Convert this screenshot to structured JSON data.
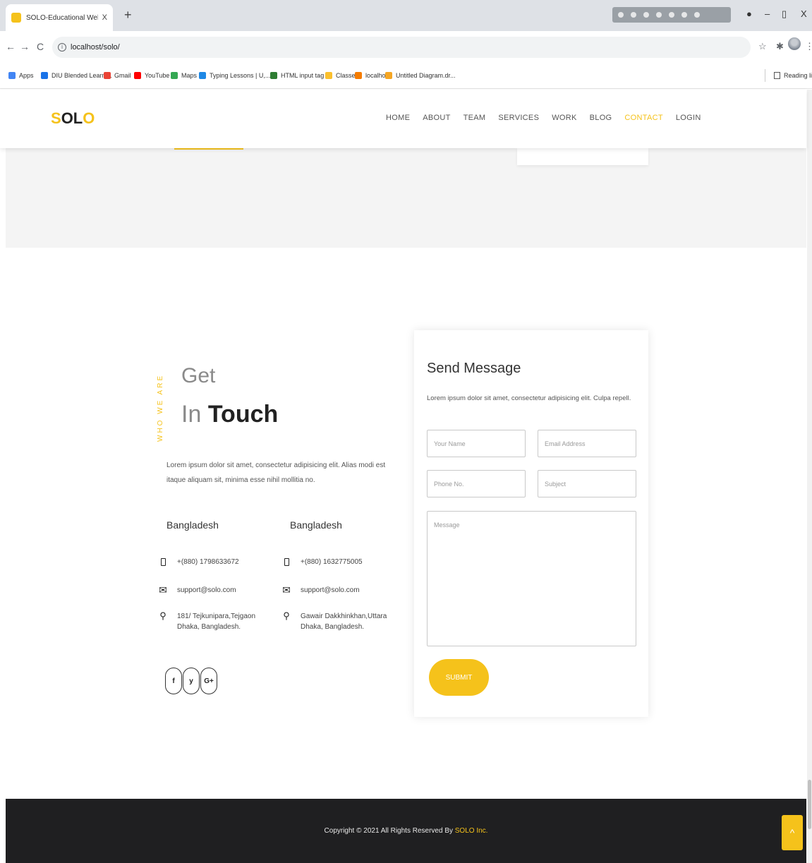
{
  "browser": {
    "tab_title": "SOLO-Educational Website",
    "tab_close": "X",
    "new_tab": "+",
    "url": "localhost/solo/",
    "back": "←",
    "forward": "→",
    "reload": "C",
    "star": "☆",
    "extensions": "✱",
    "menu": "⋮",
    "win_min": "–",
    "win_max": "▯",
    "win_close": "X",
    "bookmarks": [
      {
        "label": "Apps",
        "color": "#4285f4"
      },
      {
        "label": "DIU Blended Learni...",
        "color": "#1a73e8"
      },
      {
        "label": "Gmail",
        "color": "#ea4335"
      },
      {
        "label": "YouTube",
        "color": "#ff0000"
      },
      {
        "label": "Maps",
        "color": "#34a853"
      },
      {
        "label": "Typing Lessons | U,...",
        "color": "#1e88e5"
      },
      {
        "label": "HTML input tag",
        "color": "#2e7d32"
      },
      {
        "label": "Classes",
        "color": "#fbc02d"
      },
      {
        "label": "localhost",
        "color": "#f57c00"
      },
      {
        "label": "Untitled Diagram.dr...",
        "color": "#f5a623"
      }
    ],
    "reading_list": "Reading list"
  },
  "site": {
    "logo_first": "S",
    "logo_middle": "OL",
    "logo_last": "O",
    "nav": [
      "HOME",
      "ABOUT",
      "TEAM",
      "SERVICES",
      "WORK",
      "BLOG",
      "CONTACT",
      "LOGIN"
    ],
    "active_nav": "CONTACT",
    "accent_color": "#f5c21b"
  },
  "contact": {
    "vertical_tag": "WHO WE ARE",
    "heading_light": "Get",
    "heading_in": "In",
    "heading_bold": "Touch",
    "intro": "Lorem ipsum dolor sit amet, consectetur adipisicing elit. Alias modi est itaque aliquam sit, minima esse nihil mollitia no.",
    "offices": [
      {
        "country": "Bangladesh",
        "phone": "+(880) 1798633672",
        "email": "support@solo.com",
        "address_line1": "181/ Tejkunipara,Tejgaon",
        "address_line2": "Dhaka, Bangladesh."
      },
      {
        "country": "Bangladesh",
        "phone": "+(880) 1632775005",
        "email": "support@solo.com",
        "address_line1": "Gawair Dakkhinkhan,Uttara",
        "address_line2": "Dhaka, Bangladesh."
      }
    ],
    "socials": [
      "f",
      "y",
      "G+"
    ],
    "icons": {
      "phone": "phone-icon",
      "email": "envelope-icon",
      "address": "map-marker-icon"
    }
  },
  "form": {
    "title": "Send Message",
    "subtitle": "Lorem ipsum dolor sit amet, consectetur adipisicing elit. Culpa repell.",
    "name_placeholder": "Your Name",
    "email_placeholder": "Email Address",
    "phone_placeholder": "Phone No.",
    "subject_placeholder": "Subject",
    "message_placeholder": "Message",
    "submit_label": "SUBMIT"
  },
  "footer": {
    "copyright": "Copyright © 2021 All Rights Reserved By ",
    "brand": "SOLO Inc.",
    "to_top": "^"
  }
}
